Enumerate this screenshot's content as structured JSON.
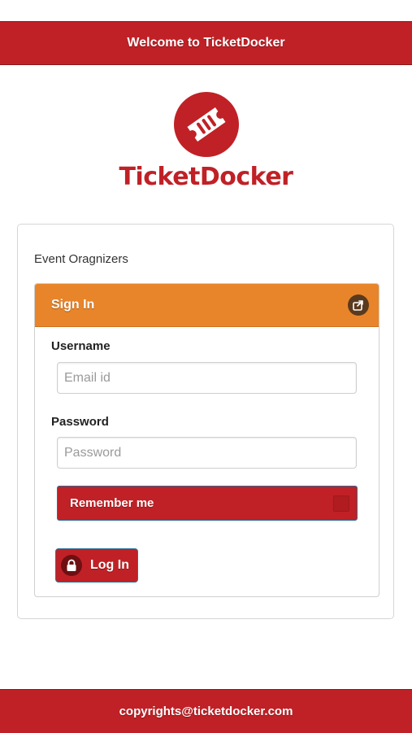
{
  "header": {
    "title": "Welcome to TicketDocker"
  },
  "logo": {
    "text": "TicketDocker",
    "icon": "ticket-logo-icon"
  },
  "card": {
    "subtitle": "Event Oragnizers",
    "panel_title": "Sign In",
    "username": {
      "label": "Username",
      "placeholder": "Email id",
      "value": ""
    },
    "password": {
      "label": "Password",
      "placeholder": "Password",
      "value": ""
    },
    "remember_label": "Remember me",
    "login_label": "Log In"
  },
  "footer": {
    "text": "copyrights@ticketdocker.com"
  },
  "colors": {
    "brand_red": "#c02126",
    "accent_orange": "#e8852a",
    "button_border": "#2c6f9a"
  }
}
